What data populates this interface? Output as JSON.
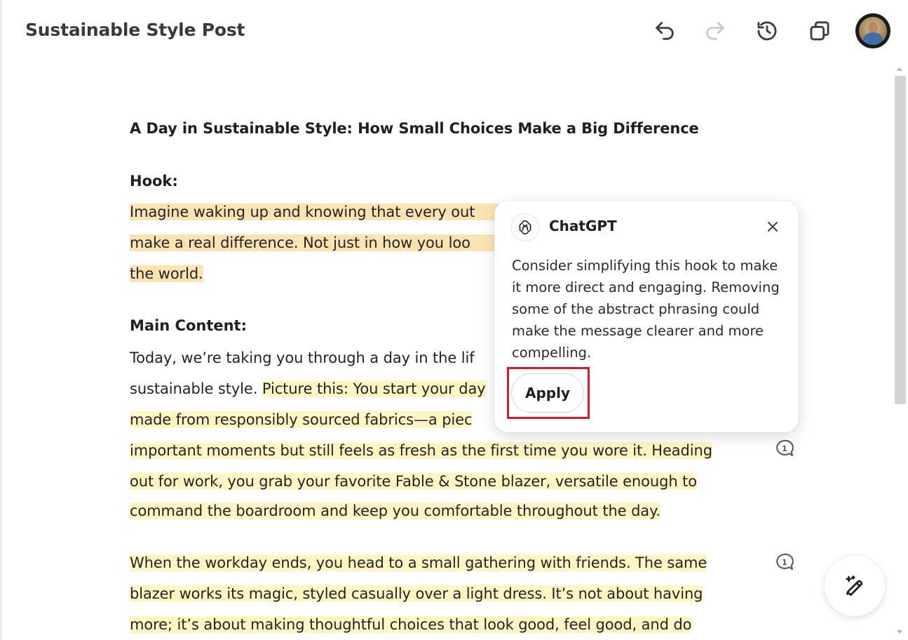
{
  "header": {
    "doc_title": "Sustainable Style Post",
    "icons": [
      "undo-icon",
      "redo-icon",
      "history-icon",
      "copy-icon"
    ]
  },
  "document": {
    "title": "A Day in Sustainable Style: How Small Choices Make a Big Difference",
    "hook_label": "Hook:",
    "hook_lines": [
      "Imagine waking up and knowing that every out",
      "make a real difference. Not just in how you loo",
      "the world."
    ],
    "main_label": "Main Content:",
    "main_para1": {
      "line1": "Today, we’re taking you through a day in the lif",
      "line2_plain": "sustainable style. ",
      "line2_hl": "Picture this: You start your day",
      "line3": "made from responsibly sourced fabrics—a piec",
      "line4_hl": "important moments but still feels as fresh as the first time you wore it.",
      "line4_tail": " Heading",
      "line5": "out for work, you grab your favorite Fable & Stone blazer, versatile enough to",
      "line6": "command the boardroom and keep you comfortable throughout the day."
    },
    "main_para2": [
      "When the workday ends, you head to a small gathering with friends. The same",
      "blazer works its magic, styled casually over a light dress. It’s not about having",
      "more; it’s about making thoughtful choices that look good, feel good, and do"
    ],
    "comment_counts": [
      "1",
      "1"
    ]
  },
  "suggestion": {
    "author": "ChatGPT",
    "message_lines": [
      "Consider simplifying this hook to make",
      "it more direct and engaging. Removing",
      "some of the abstract phrasing could",
      "make the message clearer and more",
      "compelling."
    ],
    "apply_label": "Apply"
  },
  "colors": {
    "hook_highlight": "#fde3b4",
    "content_highlight": "#fff6c4",
    "annotation_box": "#d21f2a"
  }
}
